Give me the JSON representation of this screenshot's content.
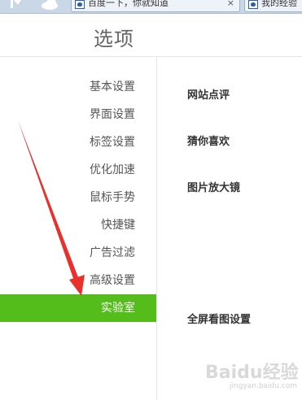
{
  "browser": {
    "tabs": [
      {
        "title": "百度一下，你就知道",
        "close": "×"
      },
      {
        "title": "我的经验"
      }
    ]
  },
  "page": {
    "title": "选项"
  },
  "sidebar": {
    "items": [
      {
        "label": "基本设置"
      },
      {
        "label": "界面设置"
      },
      {
        "label": "标签设置"
      },
      {
        "label": "优化加速"
      },
      {
        "label": "鼠标手势"
      },
      {
        "label": "快捷键"
      },
      {
        "label": "广告过滤"
      },
      {
        "label": "高级设置"
      },
      {
        "label": "实验室",
        "active": true
      }
    ],
    "accent_color": "#54bd1c"
  },
  "content": {
    "sections": [
      {
        "title": "网站点评"
      },
      {
        "title": "猜你喜欢"
      },
      {
        "title": "图片放大镜"
      },
      {
        "title": "全屏看图设置"
      }
    ]
  },
  "annotation": {
    "arrow_color": "#e8312c"
  },
  "watermark": {
    "brand": "Baidu经验",
    "url": "jingyan.baidu.com"
  }
}
